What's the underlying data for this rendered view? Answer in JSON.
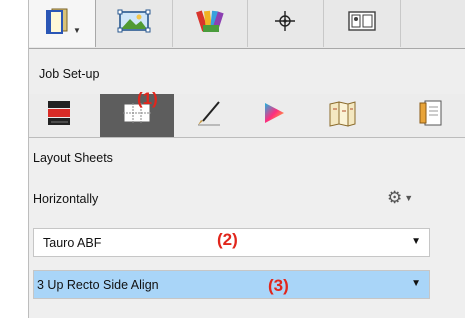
{
  "header": {
    "section_title": "Job Set-up"
  },
  "top_tabs": [
    {
      "icon": "document-manager-icon",
      "has_dropdown": true,
      "active": true
    },
    {
      "icon": "image-frame-icon",
      "active": false
    },
    {
      "icon": "color-swatches-icon",
      "active": false
    },
    {
      "icon": "crosshair-icon",
      "active": false
    },
    {
      "icon": "layout-view-icon",
      "active": false
    }
  ],
  "sub_tabs": [
    {
      "icon": "printer-stack-icon",
      "active": false
    },
    {
      "icon": "grid-layout-icon",
      "active": true
    },
    {
      "icon": "pen-icon",
      "active": false
    },
    {
      "icon": "color-triangle-icon",
      "active": false
    },
    {
      "icon": "folded-sheets-icon",
      "active": false
    },
    {
      "icon": "page-options-icon",
      "active": false
    }
  ],
  "layout": {
    "section_label": "Layout Sheets",
    "orientation_label": "Horizontally",
    "settings_icon": "gear-icon",
    "machine_select": {
      "value": "Tauro ABF"
    },
    "layout_select": {
      "value": "3 Up Recto Side Align"
    }
  },
  "annotations": {
    "a1": "(1)",
    "a2": "(2)",
    "a3": "(3)",
    "color": "#e1261c"
  },
  "colors": {
    "active_subtab": "#5d5d5d",
    "selection_highlight": "#a9d5f8",
    "panel_background": "#eeeeee"
  }
}
